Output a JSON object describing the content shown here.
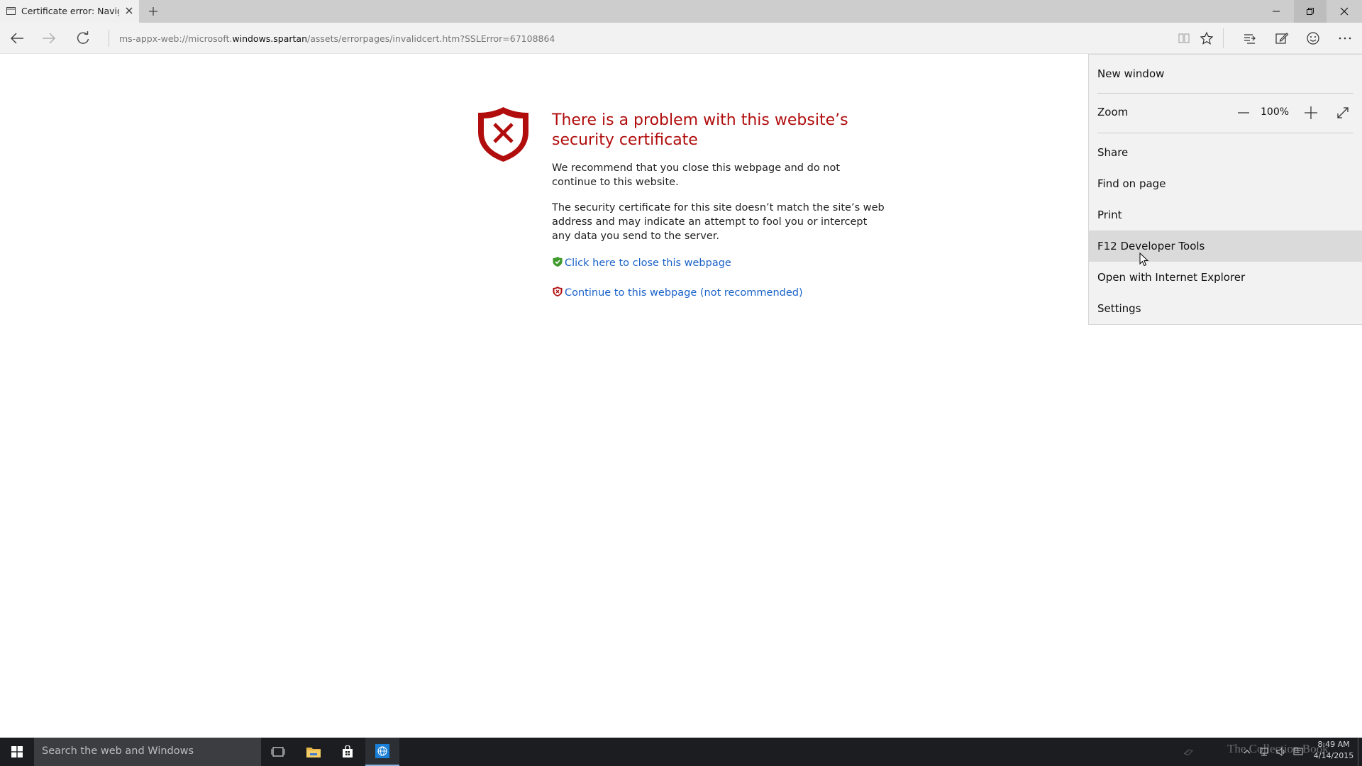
{
  "tab": {
    "title": "Certificate error: Navigatio"
  },
  "address": {
    "prefix": "ms-appx-web://microsoft.",
    "host": "windows.spartan",
    "suffix": "/assets/errorpages/invalidcert.htm?SSLError=67108864"
  },
  "error_page": {
    "title": "There is a problem with this website’s security certificate",
    "p1": "We recommend that you close this webpage and do not continue to this website.",
    "p2": "The security certificate for this site doesn’t match the site’s web address and may indicate an attempt to fool you or intercept any data you send to the server.",
    "close_link": "Click here to close this webpage",
    "continue_link": "Continue to this webpage (not recommended)"
  },
  "menu": {
    "new_window": "New window",
    "zoom_label": "Zoom",
    "zoom_value": "100%",
    "share": "Share",
    "find": "Find on page",
    "print": "Print",
    "devtools": "F12 Developer Tools",
    "open_ie": "Open with Internet Explorer",
    "settings": "Settings"
  },
  "taskbar": {
    "search_placeholder": "Search the web and Windows",
    "watermark": "The Collection Book",
    "time": "8:49 AM",
    "date": "4/14/2015"
  },
  "colors": {
    "error_red": "#b10d0d",
    "link_blue": "#1a62c9",
    "taskbar": "#1b1d21",
    "menu_hover": "#dadada"
  }
}
